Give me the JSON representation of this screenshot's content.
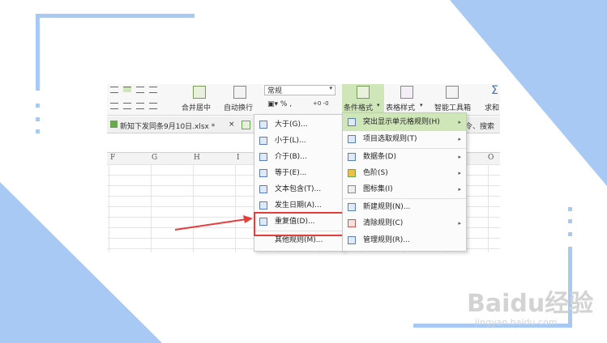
{
  "ribbon": {
    "number_format": "常规",
    "merge_center": "合并居中",
    "wrap_text": "自动换行",
    "conditional_format": "条件格式",
    "table_style": "表格样式",
    "smart_toolbox": "智能工具箱",
    "sum": "求和"
  },
  "tab": {
    "filename": "新知下发同条9月10日.xlsx *",
    "close": "×",
    "right_fragment": "令、搜索"
  },
  "columns": [
    "F",
    "G",
    "H",
    "I",
    "O"
  ],
  "submenu": {
    "items": [
      {
        "label": "大于(G)..."
      },
      {
        "label": "小于(L)..."
      },
      {
        "label": "介于(B)..."
      },
      {
        "label": "等于(E)..."
      },
      {
        "label": "文本包含(T)..."
      },
      {
        "label": "发生日期(A)..."
      },
      {
        "label": "重复值(D)..."
      },
      {
        "label": "其他规则(M)..."
      }
    ]
  },
  "main_menu": {
    "items": [
      {
        "label": "突出显示单元格规则(H)",
        "arrow": "▸"
      },
      {
        "label": "项目选取规则(T)",
        "arrow": "▸"
      },
      {
        "label": "数据条(D)",
        "arrow": "▸"
      },
      {
        "label": "色阶(S)",
        "arrow": "▸"
      },
      {
        "label": "图标集(I)",
        "arrow": "▸"
      },
      {
        "label": "新建规则(N)...",
        "arrow": ""
      },
      {
        "label": "清除规则(C)",
        "arrow": "▸"
      },
      {
        "label": "管理规则(R)...",
        "arrow": ""
      }
    ]
  },
  "watermark": {
    "brand": "Baidu经验",
    "url": "jingyan.baidu.com"
  },
  "colors": {
    "accent_blue": "#a9c9f5",
    "highlight_red": "#e53c3c",
    "menu_hover_green": "#cfe6b8"
  }
}
